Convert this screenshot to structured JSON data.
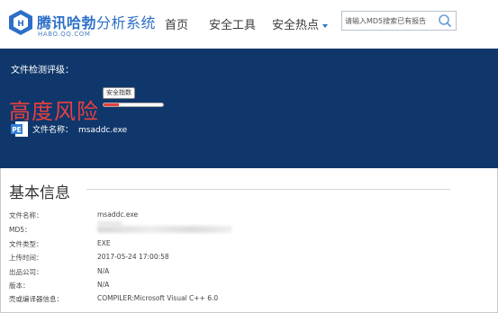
{
  "header": {
    "logo_title_bold": "腾讯哈勃",
    "logo_title_light": "分析系统",
    "logo_subtitle": "HABO.QQ.COM",
    "nav": [
      {
        "label": "首页"
      },
      {
        "label": "安全工具"
      },
      {
        "label": "安全热点"
      }
    ],
    "search_placeholder": "请输入MD5搜索已有报告"
  },
  "banner": {
    "eval_label": "文件检测评级：",
    "risk_level": "高度风险",
    "index_tag": "安全指数",
    "index_level": 0.25,
    "file_label": "文件名称：",
    "file_name": "msaddc.exe"
  },
  "basic_info": {
    "title": "基本信息",
    "rows": [
      {
        "key": "文件名称：",
        "value": "msaddc.exe"
      },
      {
        "key": "MD5：",
        "value": ""
      },
      {
        "key": "文件类型：",
        "value": "EXE"
      },
      {
        "key": "上传时间：",
        "value": "2017-05-24 17:00:58"
      },
      {
        "key": "出品公司：",
        "value": "N/A"
      },
      {
        "key": "版本：",
        "value": "N/A"
      },
      {
        "key": "壳或编译器信息：",
        "value": "COMPILER:Microsoft Visual C++ 6.0"
      }
    ]
  },
  "colors": {
    "banner_bg": "#10376b",
    "risk_red": "#e64040",
    "brand_blue": "#2d6fc6"
  },
  "icons": [
    "logo-icon",
    "search-icon",
    "pe-file-icon",
    "chevron-down-icon"
  ]
}
